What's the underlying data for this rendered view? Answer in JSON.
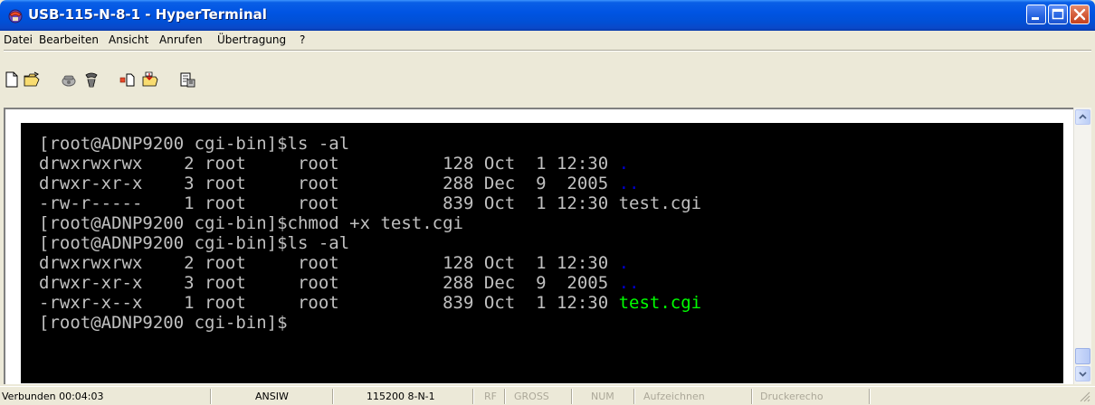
{
  "window": {
    "title": "USB-115-N-8-1 - HyperTerminal",
    "icon": "hyperterminal-phone-icon"
  },
  "menu": [
    {
      "label": "Datei"
    },
    {
      "label": "Bearbeiten"
    },
    {
      "label": "Ansicht"
    },
    {
      "label": "Anrufen"
    },
    {
      "label": "Übertragung"
    },
    {
      "label": "?"
    }
  ],
  "toolbar": [
    {
      "icon": "new-document-icon"
    },
    {
      "icon": "open-folder-icon"
    },
    {
      "icon": "call-icon"
    },
    {
      "icon": "disconnect-icon"
    },
    {
      "icon": "send-icon"
    },
    {
      "icon": "receive-icon"
    },
    {
      "icon": "properties-icon"
    }
  ],
  "terminal": {
    "lines": [
      {
        "text": "[root@ADNP9200 cgi-bin]$ls -al"
      },
      {
        "text": "drwxrwxrwx    2 root     root          128 Oct  1 12:30 ",
        "suffix": ".",
        "suffix_color": "blue"
      },
      {
        "text": "drwxr-xr-x    3 root     root          288 Dec  9  2005 ",
        "suffix": "..",
        "suffix_color": "blue"
      },
      {
        "text": "-rw-r-----    1 root     root          839 Oct  1 12:30 test.cgi"
      },
      {
        "text": "[root@ADNP9200 cgi-bin]$chmod +x test.cgi"
      },
      {
        "text": "[root@ADNP9200 cgi-bin]$ls -al"
      },
      {
        "text": "drwxrwxrwx    2 root     root          128 Oct  1 12:30 ",
        "suffix": ".",
        "suffix_color": "blue"
      },
      {
        "text": "drwxr-xr-x    3 root     root          288 Dec  9  2005 ",
        "suffix": "..",
        "suffix_color": "blue"
      },
      {
        "text": "-rwxr-x--x    1 root     root          839 Oct  1 12:30 ",
        "suffix": "test.cgi",
        "suffix_color": "green"
      },
      {
        "text": "[root@ADNP9200 cgi-bin]$"
      }
    ]
  },
  "statusbar": {
    "connected": "Verbunden 00:04:03",
    "emulation": "ANSIW",
    "port_settings": "115200 8-N-1",
    "rf": "RF",
    "gross": "GROSS",
    "num": "NUM",
    "record": "Aufzeichnen",
    "print_echo": "Druckerecho"
  },
  "colors": {
    "titlebar": "#0054e3",
    "terminal_bg": "#000000",
    "terminal_fg": "#c0c0c0",
    "dir_blue": "#0000cc",
    "exec_green": "#00ff00"
  }
}
